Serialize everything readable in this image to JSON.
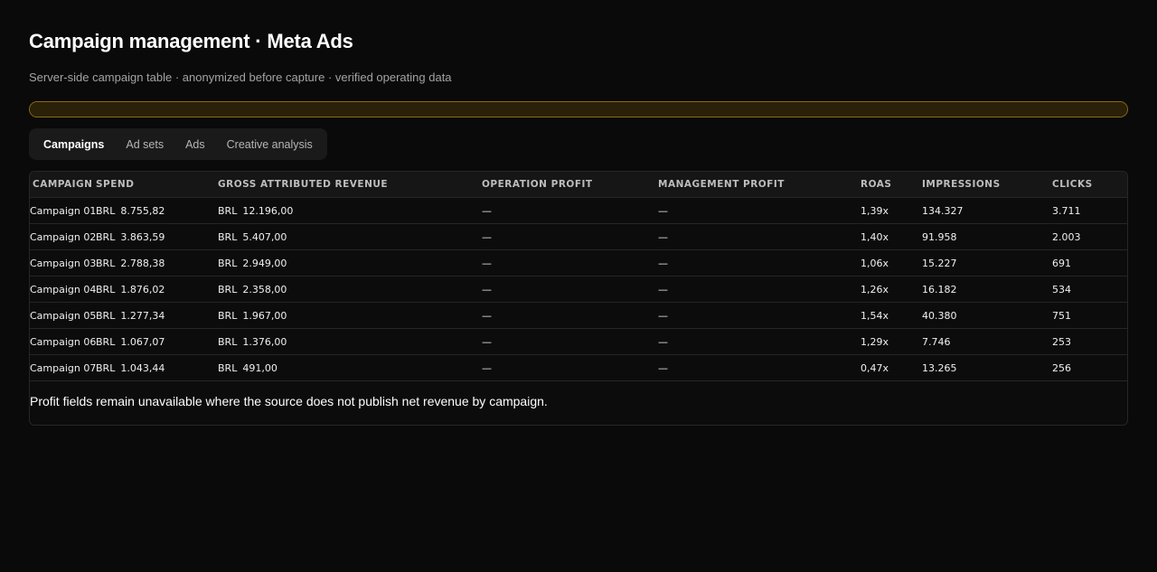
{
  "header": {
    "title": "Campaign management · Meta Ads",
    "subtitle": "Server-side campaign table · anonymized before capture · verified operating data"
  },
  "progress": {
    "fraction": 1.0,
    "border_color": "#8a6d12",
    "fill_color": "#2a2108"
  },
  "tabs": [
    {
      "label": "Campaigns",
      "active": true
    },
    {
      "label": "Ad sets",
      "active": false
    },
    {
      "label": "Ads",
      "active": false
    },
    {
      "label": "Creative analysis",
      "active": false
    }
  ],
  "table": {
    "columns": [
      "Campaign",
      "Spend",
      "Gross attributed revenue",
      "Operation profit",
      "Management profit",
      "ROAS",
      "Impressions",
      "Clicks"
    ],
    "rows": [
      {
        "campaign": "Campaign 01",
        "spend_currency": "BRL",
        "spend": "8.755,82",
        "revenue_currency": "BRL",
        "revenue": "12.196,00",
        "operation_profit": "—",
        "management_profit": "—",
        "roas": "1,39x",
        "impressions": "134.327",
        "clicks": "3.711"
      },
      {
        "campaign": "Campaign 02",
        "spend_currency": "BRL",
        "spend": "3.863,59",
        "revenue_currency": "BRL",
        "revenue": "5.407,00",
        "operation_profit": "—",
        "management_profit": "—",
        "roas": "1,40x",
        "impressions": "91.958",
        "clicks": "2.003"
      },
      {
        "campaign": "Campaign 03",
        "spend_currency": "BRL",
        "spend": "2.788,38",
        "revenue_currency": "BRL",
        "revenue": "2.949,00",
        "operation_profit": "—",
        "management_profit": "—",
        "roas": "1,06x",
        "impressions": "15.227",
        "clicks": "691"
      },
      {
        "campaign": "Campaign 04",
        "spend_currency": "BRL",
        "spend": "1.876,02",
        "revenue_currency": "BRL",
        "revenue": "2.358,00",
        "operation_profit": "—",
        "management_profit": "—",
        "roas": "1,26x",
        "impressions": "16.182",
        "clicks": "534"
      },
      {
        "campaign": "Campaign 05",
        "spend_currency": "BRL",
        "spend": "1.277,34",
        "revenue_currency": "BRL",
        "revenue": "1.967,00",
        "operation_profit": "—",
        "management_profit": "—",
        "roas": "1,54x",
        "impressions": "40.380",
        "clicks": "751"
      },
      {
        "campaign": "Campaign 06",
        "spend_currency": "BRL",
        "spend": "1.067,07",
        "revenue_currency": "BRL",
        "revenue": "1.376,00",
        "operation_profit": "—",
        "management_profit": "—",
        "roas": "1,29x",
        "impressions": "7.746",
        "clicks": "253"
      },
      {
        "campaign": "Campaign 07",
        "spend_currency": "BRL",
        "spend": "1.043,44",
        "revenue_currency": "BRL",
        "revenue": "491,00",
        "operation_profit": "—",
        "management_profit": "—",
        "roas": "0,47x",
        "impressions": "13.265",
        "clicks": "256"
      }
    ],
    "footnote": "Profit fields remain unavailable where the source does not publish net revenue by campaign."
  }
}
